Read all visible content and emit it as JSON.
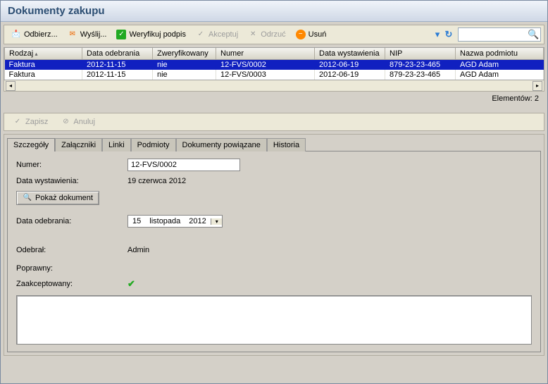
{
  "title": "Dokumenty zakupu",
  "toolbar": {
    "odbierz": "Odbierz...",
    "wyslij": "Wyślij...",
    "weryfikuj": "Weryfikuj podpis",
    "akceptuj": "Akceptuj",
    "odrzuc": "Odrzuć",
    "usun": "Usuń"
  },
  "grid": {
    "columns": [
      "Rodzaj",
      "Data odebrania",
      "Zweryfikowany",
      "Numer",
      "Data wystawienia",
      "NIP",
      "Nazwa podmiotu"
    ],
    "rows": [
      {
        "rodzaj": "Faktura",
        "data_odebrania": "2012-11-15",
        "zweryfikowany": "nie",
        "numer": "12-FVS/0002",
        "data_wyst": "2012-06-19",
        "nip": "879-23-23-465",
        "nazwa": "AGD Adam",
        "selected": true
      },
      {
        "rodzaj": "Faktura",
        "data_odebrania": "2012-11-15",
        "zweryfikowany": "nie",
        "numer": "12-FVS/0003",
        "data_wyst": "2012-06-19",
        "nip": "879-23-23-465",
        "nazwa": "AGD Adam",
        "selected": false
      }
    ],
    "count_label": "Elementów: 2"
  },
  "detailbar": {
    "zapisz": "Zapisz",
    "anuluj": "Anuluj"
  },
  "tabs": [
    "Szczegóły",
    "Załączniki",
    "Linki",
    "Podmioty",
    "Dokumenty powiązane",
    "Historia"
  ],
  "details": {
    "numer_label": "Numer:",
    "numer_value": "12-FVS/0002",
    "data_wyst_label": "Data wystawienia:",
    "data_wyst_value": "19 czerwca 2012",
    "pokaz_dokument": "Pokaż dokument",
    "data_odebr_label": "Data odebrania:",
    "data_odebr_value": {
      "d": "15",
      "m": "listopada",
      "y": "2012"
    },
    "odebral_label": "Odebrał:",
    "odebral_value": "Admin",
    "poprawny_label": "Poprawny:",
    "zaakcept_label": "Zaakceptowany:"
  }
}
